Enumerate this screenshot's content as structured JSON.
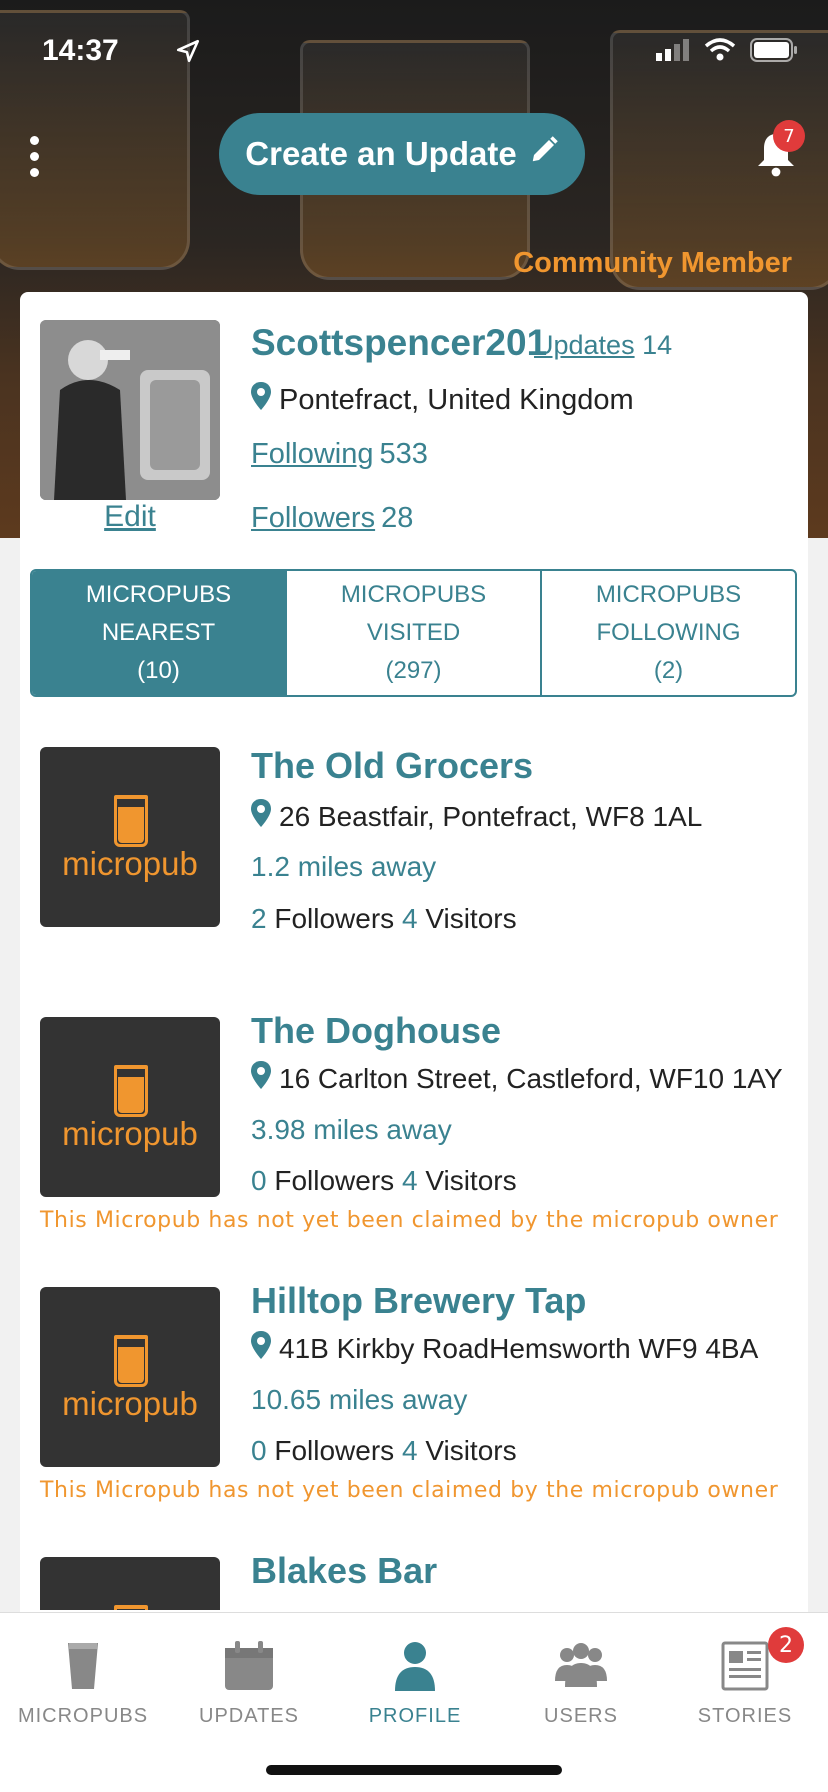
{
  "status_bar": {
    "time": "14:37"
  },
  "header": {
    "create_button_label": "Create an Update",
    "notification_count": "7",
    "member_label": "Community Member"
  },
  "profile": {
    "username": "Scottspencer201",
    "updates_label": "Updates",
    "updates_count": "14",
    "location": "Pontefract, United Kingdom",
    "following_label": "Following",
    "following_count": "533",
    "followers_label": "Followers",
    "followers_count": "28",
    "edit_label": "Edit"
  },
  "tabs": [
    {
      "line1": "MICROPUBS",
      "line2": "NEAREST",
      "count": "(10)",
      "active": true
    },
    {
      "line1": "MICROPUBS",
      "line2": "VISITED",
      "count": "(297)",
      "active": false
    },
    {
      "line1": "MICROPUBS",
      "line2": "FOLLOWING",
      "count": "(2)",
      "active": false
    }
  ],
  "logo_word": "micropub",
  "pubs": [
    {
      "name": "The Old Grocers",
      "address": "26 Beastfair, Pontefract, WF8 1AL",
      "distance": "1.2 miles away",
      "followers": "2",
      "followers_label": "Followers",
      "visitors": "4",
      "visitors_label": "Visitors",
      "warning": ""
    },
    {
      "name": "The Doghouse",
      "address": "16 Carlton Street, Castleford, WF10 1AY",
      "distance": "3.98 miles away",
      "followers": "0",
      "followers_label": "Followers",
      "visitors": "4",
      "visitors_label": "Visitors",
      "warning": "This Micropub has not yet been claimed by the micropub owner"
    },
    {
      "name": "Hilltop Brewery Tap",
      "address": "41B Kirkby RoadHemsworth WF9 4BA",
      "distance": "10.65 miles away",
      "followers": "0",
      "followers_label": "Followers",
      "visitors": "4",
      "visitors_label": "Visitors",
      "warning": "This Micropub has not yet been claimed by the micropub owner"
    },
    {
      "name": "Blakes Bar"
    }
  ],
  "bottom_nav": [
    {
      "label": "MICROPUBS",
      "icon": "pint-icon"
    },
    {
      "label": "UPDATES",
      "icon": "calendar-icon"
    },
    {
      "label": "PROFILE",
      "icon": "person-icon",
      "active": true
    },
    {
      "label": "USERS",
      "icon": "users-icon"
    },
    {
      "label": "STORIES",
      "icon": "newspaper-icon",
      "badge": "2"
    }
  ],
  "colors": {
    "teal": "#3a8290",
    "orange": "#f0962f",
    "badge_red": "#e03b3b"
  }
}
